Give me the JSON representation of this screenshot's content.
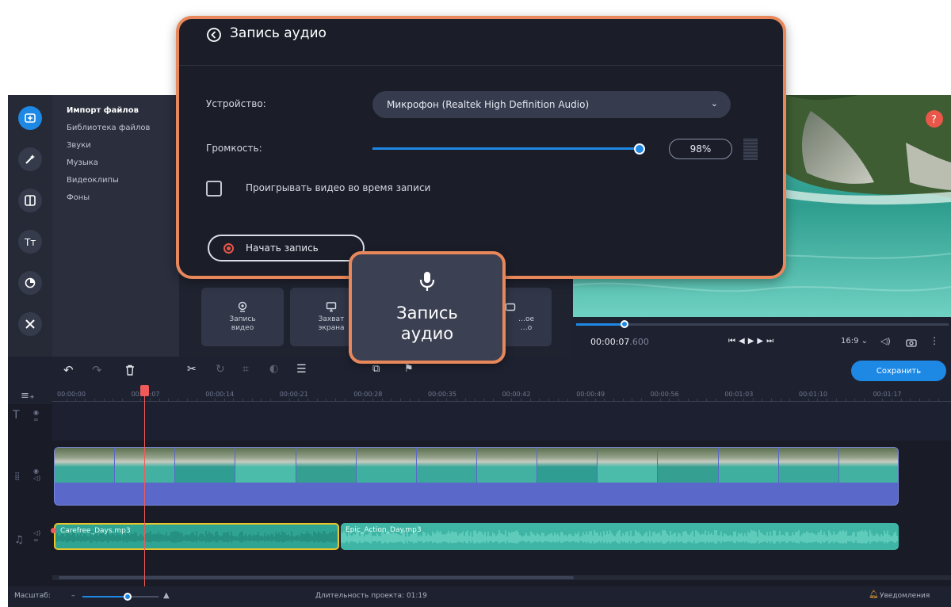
{
  "panel": {
    "title": "Запись аудио",
    "device_label": "Устройство:",
    "device_value": "Микрофон (Realtek High Definition Audio)",
    "volume_label": "Громкость:",
    "volume_value": "98%",
    "volume_level": 0.98,
    "checkbox_label": "Проигрывать видео во время записи",
    "record_label": "Начать запись"
  },
  "callout": {
    "label": "Запись\nаудио",
    "icon": "microphone-icon"
  },
  "sidebar": {
    "tools": [
      "import-icon",
      "magic-wand-icon",
      "transitions-icon",
      "titles-icon",
      "stickers-icon",
      "more-tools-icon"
    ],
    "menu": [
      "Импорт файлов",
      "Библиотека файлов",
      "Звуки",
      "Музыка",
      "Видеоклипы",
      "Фоны"
    ]
  },
  "import": {
    "buttons": [
      {
        "label": "Запись\nвидео",
        "icon": "webcam-icon"
      },
      {
        "label": "Захват\nэкрана",
        "icon": "monitor-icon"
      },
      {
        "label": "…ое\n…о",
        "icon": "camera-icon"
      }
    ]
  },
  "player": {
    "time_main": "00:00:07",
    "time_frac": ".600",
    "aspect": "16:9",
    "progress": 0.13
  },
  "timeline": {
    "save_label": "Сохранить",
    "ticks": [
      "00:00:00",
      "00:00:07",
      "00:00:14",
      "00:00:21",
      "00:00:28",
      "00:00:35",
      "00:00:42",
      "00:00:49",
      "00:00:56",
      "00:01:03",
      "00:01:10",
      "00:01:17"
    ],
    "audio_clip_1": "Carefree_Days.mp3",
    "audio_clip_2": "Epic_Action_Day.mp3"
  },
  "status": {
    "zoom_label": "Масштаб:",
    "duration_label": "Длительность проекта: 01:19",
    "notifications_label": "Уведомления"
  },
  "colors": {
    "accent": "#1e88e5",
    "highlight": "#e8875a",
    "video_track": "#5a68c9",
    "audio_track": "#3fb6a5",
    "selected_clip_border": "#e8c62b",
    "playhead": "#f05a5a"
  }
}
